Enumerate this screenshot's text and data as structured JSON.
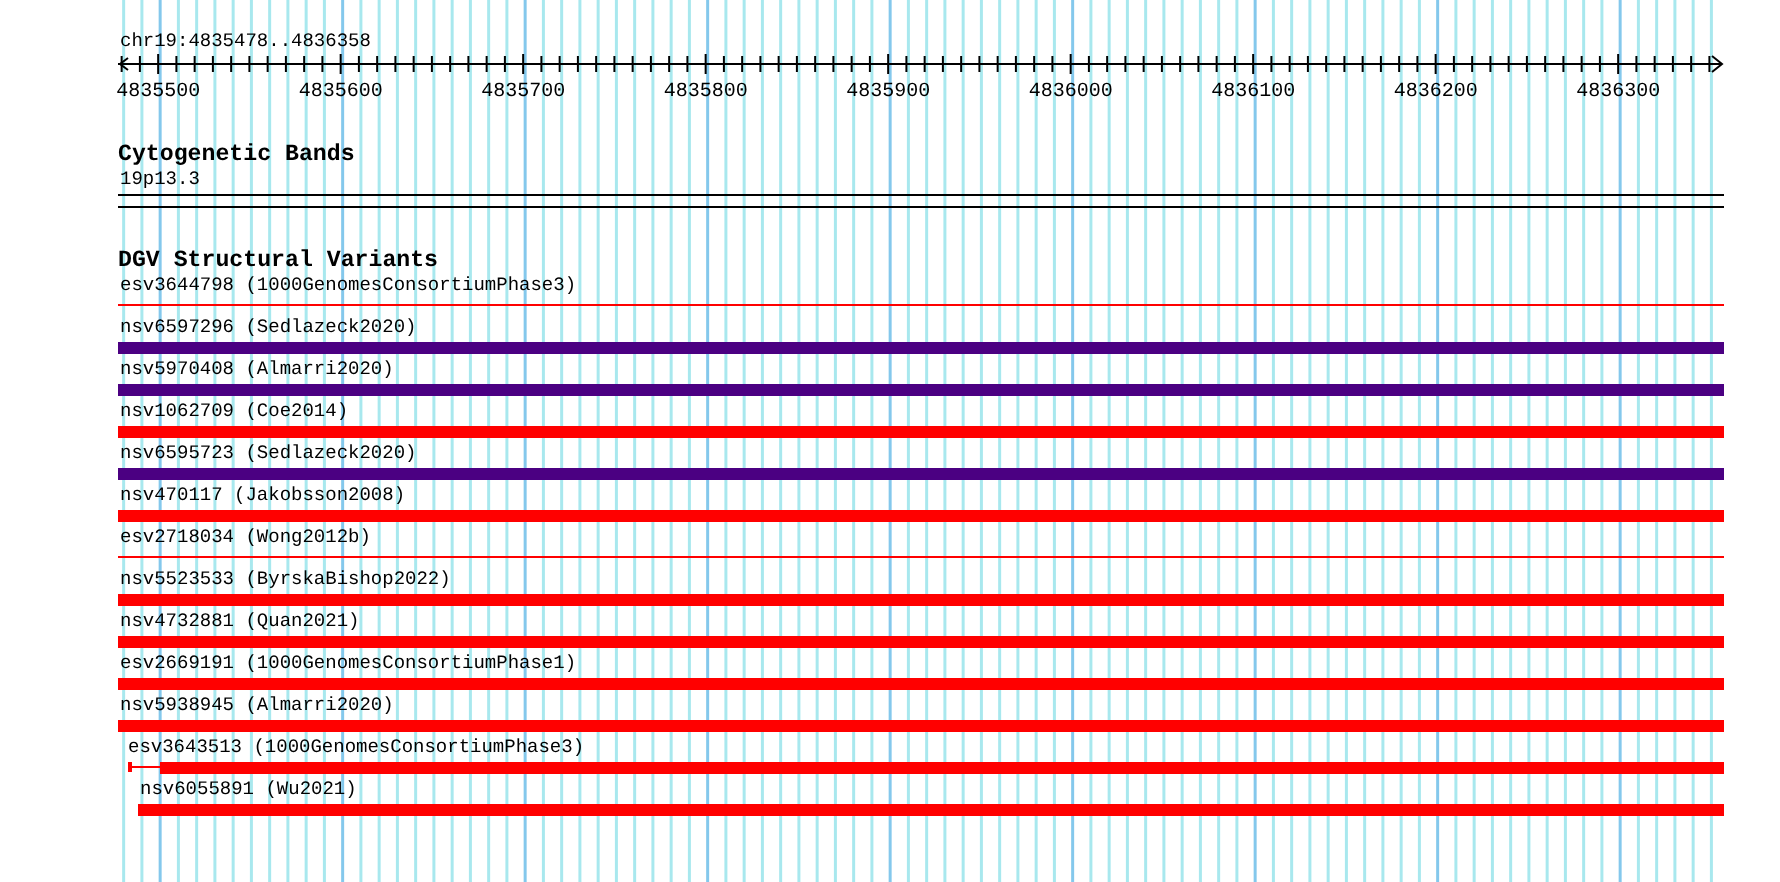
{
  "ruler": {
    "range": "chr19:4835478..4836358",
    "ticks": [
      "4835500",
      "4835600",
      "4835700",
      "4835800",
      "4835900",
      "4836000",
      "4836100",
      "4836200",
      "4836300"
    ]
  },
  "cytogenetic_bands": {
    "title": "Cytogenetic Bands",
    "band": "19p13.3"
  },
  "dgv_structural_variants": {
    "title": "DGV Structural Variants",
    "features": [
      {
        "label": "esv3644798 (1000GenomesConsortiumPhase3)",
        "kind": "line",
        "color": "#ff0000"
      },
      {
        "label": "nsv6597296 (Sedlazeck2020)",
        "kind": "bar",
        "color": "#4b0082"
      },
      {
        "label": "nsv5970408 (Almarri2020)",
        "kind": "bar",
        "color": "#4b0082"
      },
      {
        "label": "nsv1062709 (Coe2014)",
        "kind": "bar",
        "color": "#ff0000"
      },
      {
        "label": "nsv6595723 (Sedlazeck2020)",
        "kind": "bar",
        "color": "#4b0082"
      },
      {
        "label": "nsv470117 (Jakobsson2008)",
        "kind": "bar",
        "color": "#ff0000"
      },
      {
        "label": "esv2718034 (Wong2012b)",
        "kind": "line",
        "color": "#ff0000"
      },
      {
        "label": "nsv5523533 (ByrskaBishop2022)",
        "kind": "bar",
        "color": "#ff0000"
      },
      {
        "label": "nsv4732881 (Quan2021)",
        "kind": "bar",
        "color": "#ff0000"
      },
      {
        "label": "esv2669191 (1000GenomesConsortiumPhase1)",
        "kind": "bar",
        "color": "#ff0000"
      },
      {
        "label": "nsv5938945 (Almarri2020)",
        "kind": "bar",
        "color": "#ff0000"
      },
      {
        "label": "esv3643513 (1000GenomesConsortiumPhase3)",
        "kind": "split",
        "color": "#ff0000"
      },
      {
        "label": "nsv6055891 (Wu2021)",
        "kind": "inset",
        "color": "#ff0000"
      }
    ]
  }
}
